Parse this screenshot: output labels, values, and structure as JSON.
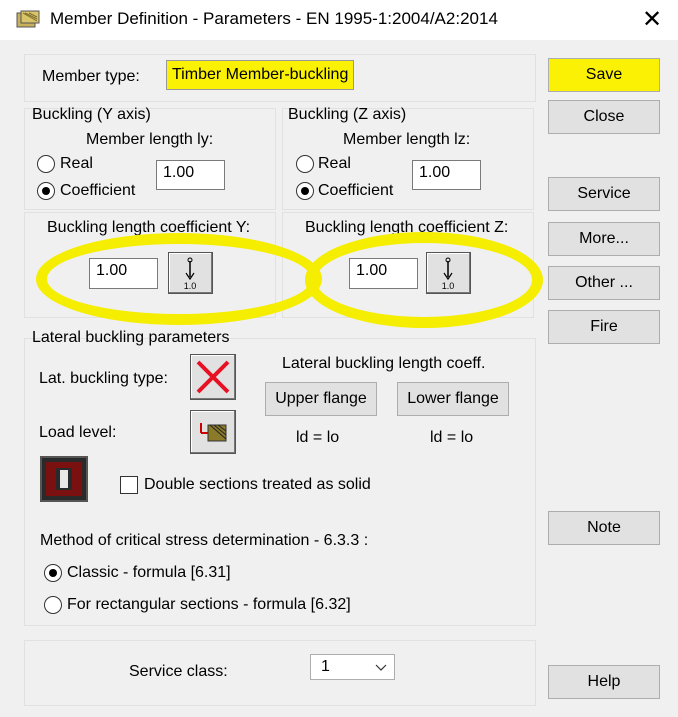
{
  "window": {
    "title": "Member Definition - Parameters - EN 1995-1:2004/A2:2014",
    "close_glyph": "✕"
  },
  "member": {
    "type_label": "Member type:",
    "type_value": "Timber Member-buckling"
  },
  "buckling_y": {
    "title": "Buckling (Y axis)",
    "length_label": "Member length ly:",
    "real": "Real",
    "coefficient": "Coefficient",
    "length_value": "1.00",
    "coef_label": "Buckling length coefficient Y:",
    "coef_value": "1.00",
    "icon_value": "1.0"
  },
  "buckling_z": {
    "title": "Buckling (Z axis)",
    "length_label": "Member length lz:",
    "real": "Real",
    "coefficient": "Coefficient",
    "length_value": "1.00",
    "coef_label": "Buckling length coefficient Z:",
    "coef_value": "1.00",
    "icon_value": "1.0"
  },
  "lateral": {
    "title": "Lateral buckling parameters",
    "type_label": "Lat. buckling type:",
    "load_label": "Load level:",
    "coeff_label": "Lateral buckling length coeff.",
    "upper_flange": "Upper flange",
    "lower_flange": "Lower flange",
    "upper_formula": "ld =  lo",
    "lower_formula": "ld =  lo",
    "double_sections": "Double sections treated as solid",
    "method_label": "Method of critical stress determination - 6.3.3 :",
    "classic": "Classic - formula [6.31]",
    "rectangular": "For rectangular sections - formula [6.32]"
  },
  "service": {
    "label": "Service class:",
    "value": "1"
  },
  "buttons": {
    "save": "Save",
    "close": "Close",
    "service": "Service",
    "more": "More...",
    "other": "Other ...",
    "fire": "Fire",
    "note": "Note",
    "help": "Help"
  },
  "colors": {
    "highlight": "#fbf104",
    "dialog_bg": "#f0f0f0",
    "button_bg": "#e1e1e1",
    "lateral_red": "#e81123"
  }
}
